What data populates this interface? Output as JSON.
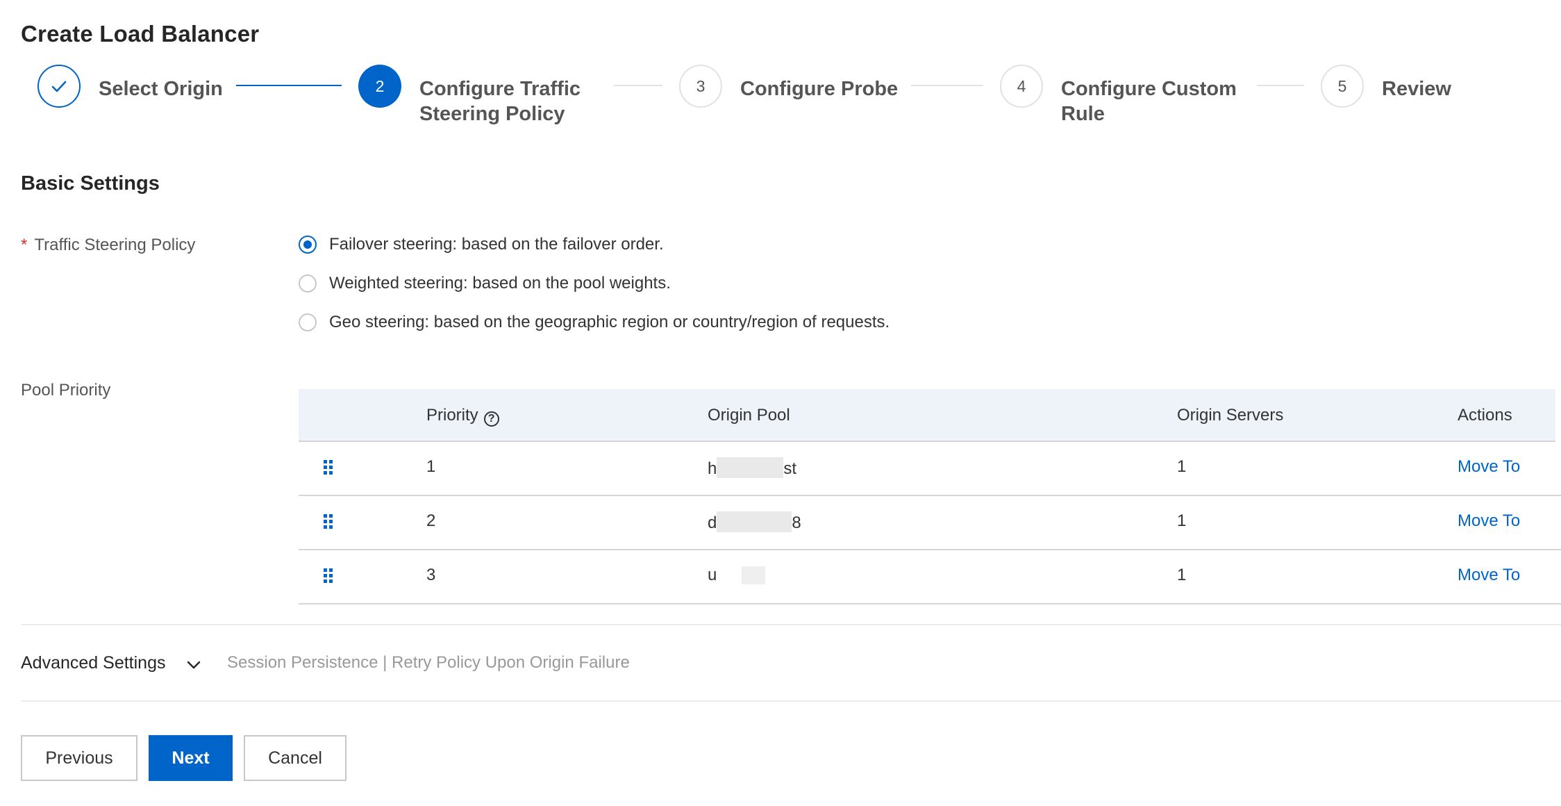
{
  "page": {
    "title": "Create Load Balancer"
  },
  "steps": [
    {
      "index": "✓",
      "title": "Select Origin",
      "status": "done"
    },
    {
      "index": "2",
      "title_line1": "Configure Traffic",
      "title_line2": "Steering Policy",
      "status": "active"
    },
    {
      "index": "3",
      "title": "Configure Probe",
      "status": "pending"
    },
    {
      "index": "4",
      "title_line1": "Configure Custom",
      "title_line2": "Rule",
      "status": "pending"
    },
    {
      "index": "5",
      "title": "Review",
      "status": "pending"
    }
  ],
  "basic": {
    "section_title": "Basic Settings",
    "policy_label": "Traffic Steering Policy",
    "required_mark": "*",
    "options": [
      {
        "label": "Failover steering: based on the failover order.",
        "checked": true
      },
      {
        "label": "Weighted steering: based on the pool weights.",
        "checked": false
      },
      {
        "label": "Geo steering: based on the geographic region or country/region of requests.",
        "checked": false
      }
    ],
    "pool_priority_label": "Pool Priority"
  },
  "table": {
    "headers": {
      "priority": "Priority",
      "priority_help": "?",
      "origin_pool": "Origin Pool",
      "origin_servers": "Origin Servers",
      "actions": "Actions"
    },
    "rows": [
      {
        "priority": "1",
        "pool_prefix": "h",
        "pool_suffix": "st",
        "servers": "1",
        "action": "Move To"
      },
      {
        "priority": "2",
        "pool_prefix": "d",
        "pool_suffix": "8",
        "servers": "1",
        "action": "Move To"
      },
      {
        "priority": "3",
        "pool_prefix": "u",
        "pool_suffix": "",
        "servers": "1",
        "action": "Move To"
      }
    ]
  },
  "advanced": {
    "title": "Advanced Settings",
    "hint": "Session Persistence | Retry Policy Upon Origin Failure"
  },
  "buttons": {
    "previous": "Previous",
    "next": "Next",
    "cancel": "Cancel"
  },
  "colors": {
    "accent": "#0064c8",
    "required": "#d93026",
    "header_bg": "#eef2f9"
  },
  "icons": {
    "done": "check-icon",
    "help": "help-circle-icon",
    "drag": "drag-handle-icon",
    "expand": "chevron-down-icon"
  }
}
